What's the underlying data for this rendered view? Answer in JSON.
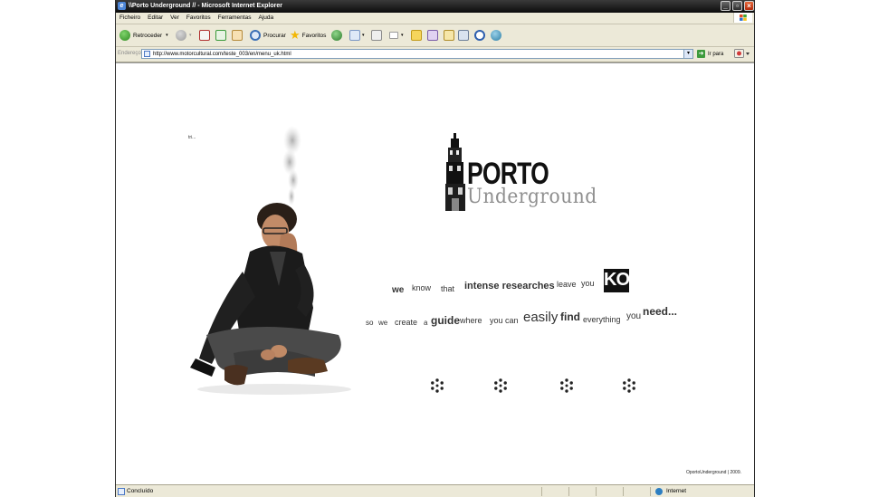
{
  "window": {
    "title": "\\\\Porto Underground // - Microsoft Internet Explorer",
    "controls": [
      "minimize",
      "maximize",
      "close"
    ]
  },
  "menu": {
    "items": [
      "Ficheiro",
      "Editar",
      "Ver",
      "Favoritos",
      "Ferramentas",
      "Ajuda"
    ]
  },
  "toolbar": {
    "back_label": "Retroceder",
    "search_label": "Procurar",
    "favorites_label": "Favoritos"
  },
  "address": {
    "label": "Endereço",
    "url": "http://www.motorcultural.com/teste_003/en/menu_uk.html",
    "go_label": "Ir para"
  },
  "page": {
    "breadcrumb": "tri...",
    "logo": {
      "line1": "PORTO",
      "line2": "Underground"
    },
    "tagline": {
      "line1": [
        "we",
        "know",
        "that",
        "intense researches",
        "leave",
        "you",
        "KO"
      ],
      "line2": [
        "so",
        "we",
        "create",
        "a",
        "guide",
        "where",
        "you can",
        "easily",
        "find",
        "everything",
        "you",
        "need..."
      ]
    },
    "nav_items": [
      "nav-1",
      "nav-2",
      "nav-3",
      "nav-4"
    ],
    "copyright": "OportoUnderground | 2009."
  },
  "statusbar": {
    "status": "Concluído",
    "zone": "Internet"
  },
  "colors": {
    "titlebar": "#1a1a1a",
    "chrome": "#ece9d8",
    "logo_dark": "#111111",
    "logo_grey": "#8f8f8f",
    "text": "#333333"
  }
}
